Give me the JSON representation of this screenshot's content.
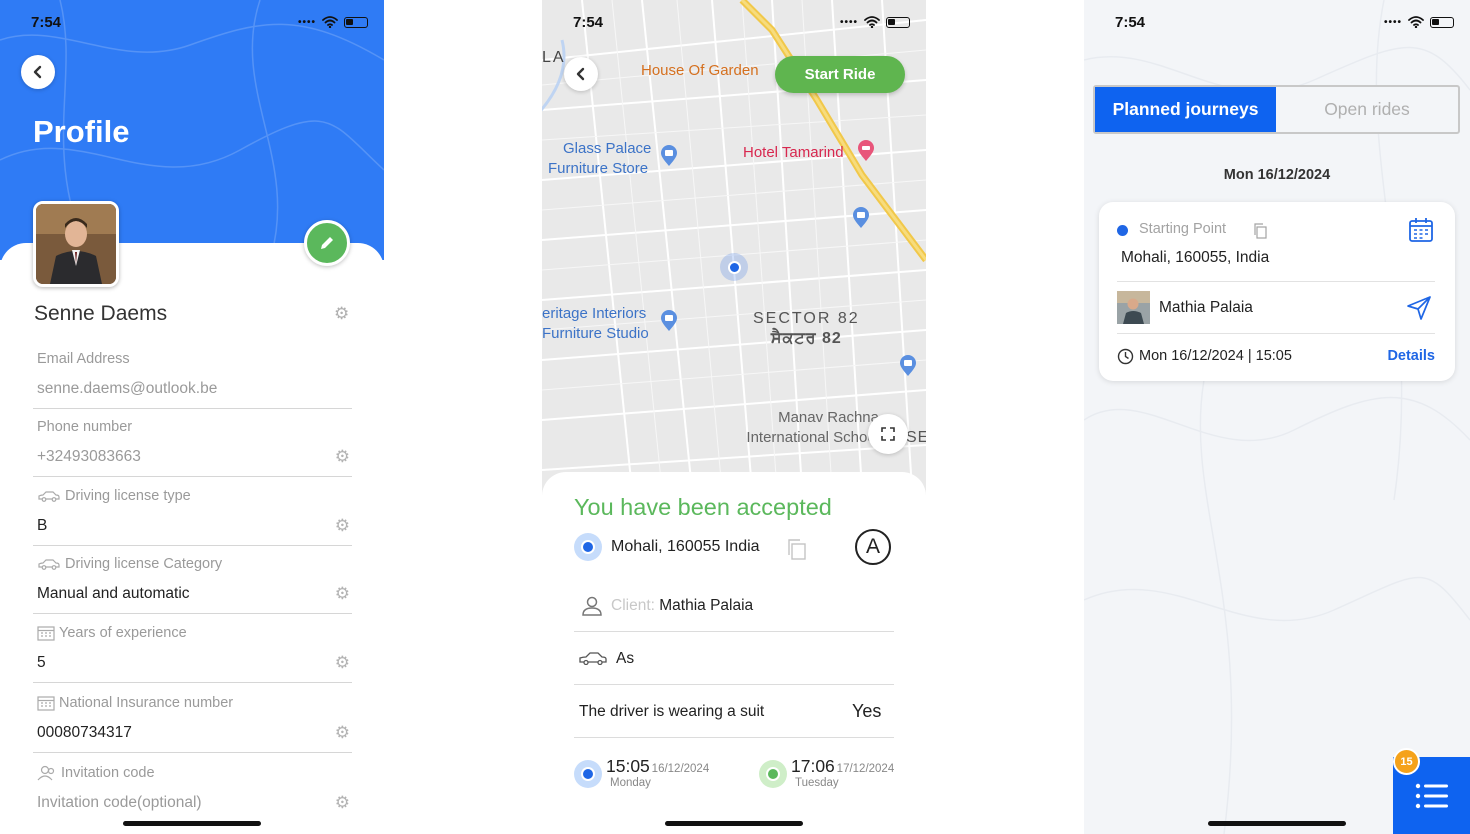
{
  "status": {
    "time": "7:54"
  },
  "profile": {
    "title": "Profile",
    "name": "Senne Daems",
    "fields": [
      {
        "label": "Email Address",
        "value": "senne.daems@outlook.be",
        "muted": true,
        "icon": ""
      },
      {
        "label": "Phone number",
        "value": "+32493083663",
        "muted": true,
        "icon": ""
      },
      {
        "label": "Driving license type",
        "value": "B",
        "muted": false,
        "icon": "car-icon"
      },
      {
        "label": "Driving license Category",
        "value": "Manual and automatic",
        "muted": false,
        "icon": "car-icon"
      },
      {
        "label": "Years of experience",
        "value": "5",
        "muted": false,
        "icon": "calendar-icon"
      },
      {
        "label": "National Insurance number",
        "value": "00080734317",
        "muted": false,
        "icon": "calendar-icon"
      },
      {
        "label": "Invitation code",
        "value": "Invitation code(optional)",
        "muted": true,
        "icon": "people-icon"
      }
    ]
  },
  "ride": {
    "start_ride": "Start Ride",
    "map_labels": {
      "house_of_garden": "House Of Garden",
      "glass_palace_1": "Glass Palace",
      "glass_palace_2": "Furniture Store",
      "hotel": "Hotel Tamarind",
      "heritage_1": "eritage Interiors",
      "heritage_2": "Furniture Studio",
      "sector_1": "SECTOR 82",
      "sector_2": "ਸੈਕਟਰ 82",
      "manav_1": "Manav Rachna",
      "manav_2": "International School",
      "la": "LA",
      "se": "SE"
    },
    "accepted": "You have been accepted",
    "address": "Mohali, 160055 India",
    "client_label": "Client:",
    "client_name": "Mathia Palaia",
    "car_text": "As",
    "suit_question": "The driver is wearing a suit",
    "suit_answer": "Yes",
    "start": {
      "time": "15:05",
      "date": "16/12/2024",
      "day": "Monday"
    },
    "end": {
      "time": "17:06",
      "date": "17/12/2024",
      "day": "Tuesday"
    }
  },
  "journeys": {
    "tab_planned": "Planned journeys",
    "tab_open": "Open rides",
    "date_heading": "Mon 16/12/2024",
    "starting_point_label": "Starting Point",
    "starting_point_value": "Mohali, 160055, India",
    "driver_name": "Mathia Palaia",
    "datetime": "Mon 16/12/2024 | 15:05",
    "details": "Details",
    "badge_count": "15"
  },
  "colors": {
    "primary_blue": "#2f7bf5",
    "tab_blue": "#0e63f0",
    "green": "#5bb85c",
    "badge_orange": "#f5a21a"
  }
}
